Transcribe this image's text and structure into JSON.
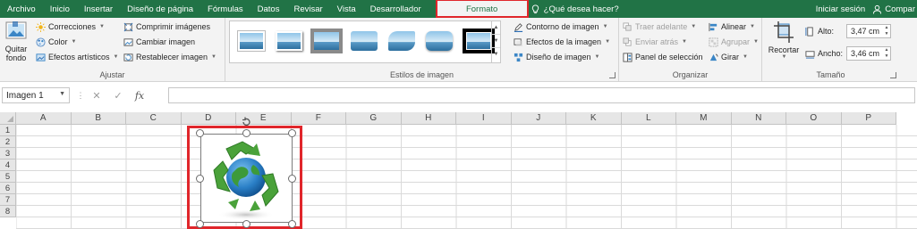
{
  "tabs": [
    "Archivo",
    "Inicio",
    "Insertar",
    "Diseño de página",
    "Fórmulas",
    "Datos",
    "Revisar",
    "Vista",
    "Desarrollador",
    "Formato"
  ],
  "active_tab": "Formato",
  "tell_me": "¿Qué desea hacer?",
  "sign_in": "Iniciar sesión",
  "share": "Compar",
  "ribbon": {
    "adjust": {
      "remove_bg": [
        "Quitar",
        "fondo"
      ],
      "corrections": "Correcciones",
      "color": "Color",
      "artistic": "Efectos artísticos",
      "compress": "Comprimir imágenes",
      "change": "Cambiar imagen",
      "reset": "Restablecer imagen",
      "label": "Ajustar"
    },
    "styles": {
      "border": "Contorno de imagen",
      "effects": "Efectos de la imagen",
      "layout": "Diseño de imagen",
      "label": "Estilos de imagen"
    },
    "arrange": {
      "bring_forward": "Traer adelante",
      "send_backward": "Enviar atrás",
      "selection_pane": "Panel de selección",
      "align": "Alinear",
      "group": "Agrupar",
      "rotate": "Girar",
      "label": "Organizar"
    },
    "size": {
      "crop": "Recortar",
      "height_label": "Alto:",
      "height_value": "3,47 cm",
      "width_label": "Ancho:",
      "width_value": "3,46 cm",
      "label": "Tamaño"
    }
  },
  "name_box": "Imagen 1",
  "formula_value": "",
  "columns": [
    "A",
    "B",
    "C",
    "D",
    "E",
    "F",
    "G",
    "H",
    "I",
    "J",
    "K",
    "L",
    "M",
    "N",
    "O",
    "P"
  ],
  "rows": [
    "1",
    "2",
    "3",
    "4",
    "5",
    "6",
    "7",
    "8"
  ],
  "colors": {
    "accent": "#217346",
    "highlight": "#e0262b"
  }
}
